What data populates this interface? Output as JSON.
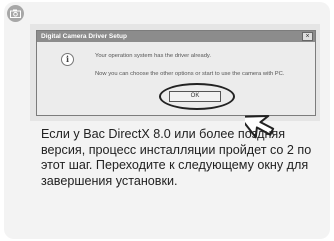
{
  "dialog": {
    "title": "Digital Camera Driver Setup",
    "close_label": "×",
    "message_line1": "Your operation system has the driver already.",
    "message_line2": "Now you can choose the other options or start to use the camera with PC.",
    "ok_button_label": "OK",
    "icon": "info-icon"
  },
  "badge": {
    "icon": "camera-icon"
  },
  "instruction": {
    "text": "Если у Вас DirectX 8.0 или более поздняя версия, процесс инсталляции пройдет со 2 по этот шаг. Переходите к следующему окну для завершения установки."
  },
  "colors": {
    "panel_background": "#f3f3f3",
    "badge": "#a7a7a7",
    "titlebar": "#8c8c8c"
  }
}
